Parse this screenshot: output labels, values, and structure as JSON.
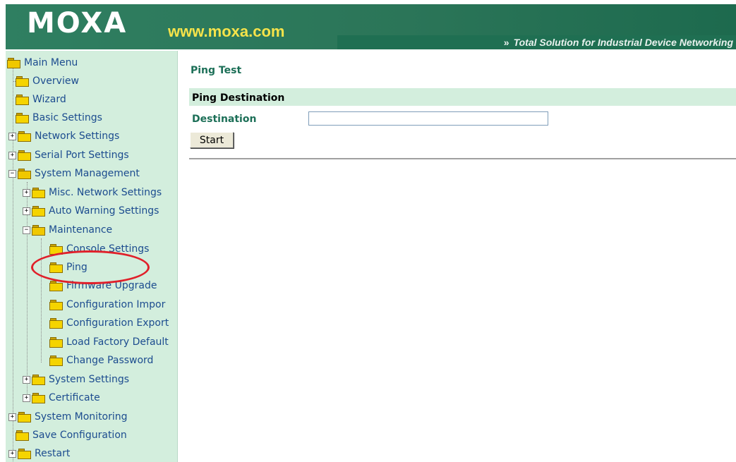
{
  "header": {
    "logo": "MOXA",
    "site_url": "www.moxa.com",
    "tagline_chevrons": "»",
    "tagline": "Total Solution for Industrial Device Networking"
  },
  "sidebar": {
    "items": [
      {
        "label": "Main Menu",
        "expander": ""
      },
      {
        "label": "Overview",
        "expander": ""
      },
      {
        "label": "Wizard",
        "expander": ""
      },
      {
        "label": "Basic Settings",
        "expander": ""
      },
      {
        "label": "Network Settings",
        "expander": "+"
      },
      {
        "label": "Serial Port Settings",
        "expander": "+"
      },
      {
        "label": "System Management",
        "expander": "−"
      },
      {
        "label": "Misc. Network Settings",
        "expander": "+"
      },
      {
        "label": "Auto Warning Settings",
        "expander": "+"
      },
      {
        "label": "Maintenance",
        "expander": "−"
      },
      {
        "label": "Console Settings",
        "expander": ""
      },
      {
        "label": "Ping",
        "expander": ""
      },
      {
        "label": "Firmware Upgrade",
        "expander": ""
      },
      {
        "label": "Configuration Impor",
        "expander": ""
      },
      {
        "label": "Configuration Export",
        "expander": ""
      },
      {
        "label": "Load Factory Default",
        "expander": ""
      },
      {
        "label": "Change Password",
        "expander": ""
      },
      {
        "label": "System Settings",
        "expander": "+"
      },
      {
        "label": "Certificate",
        "expander": "+"
      },
      {
        "label": "System Monitoring",
        "expander": "+"
      },
      {
        "label": "Save Configuration",
        "expander": ""
      },
      {
        "label": "Restart",
        "expander": "+"
      }
    ]
  },
  "main": {
    "page_title": "Ping Test",
    "section_title": "Ping Destination",
    "destination_label": "Destination",
    "destination_value": "",
    "start_label": "Start"
  },
  "colors": {
    "banner": "#2e7a5e",
    "sidebar_bg": "#d3eedd",
    "label_green": "#1c6f57",
    "highlight_red": "#e0202a"
  }
}
